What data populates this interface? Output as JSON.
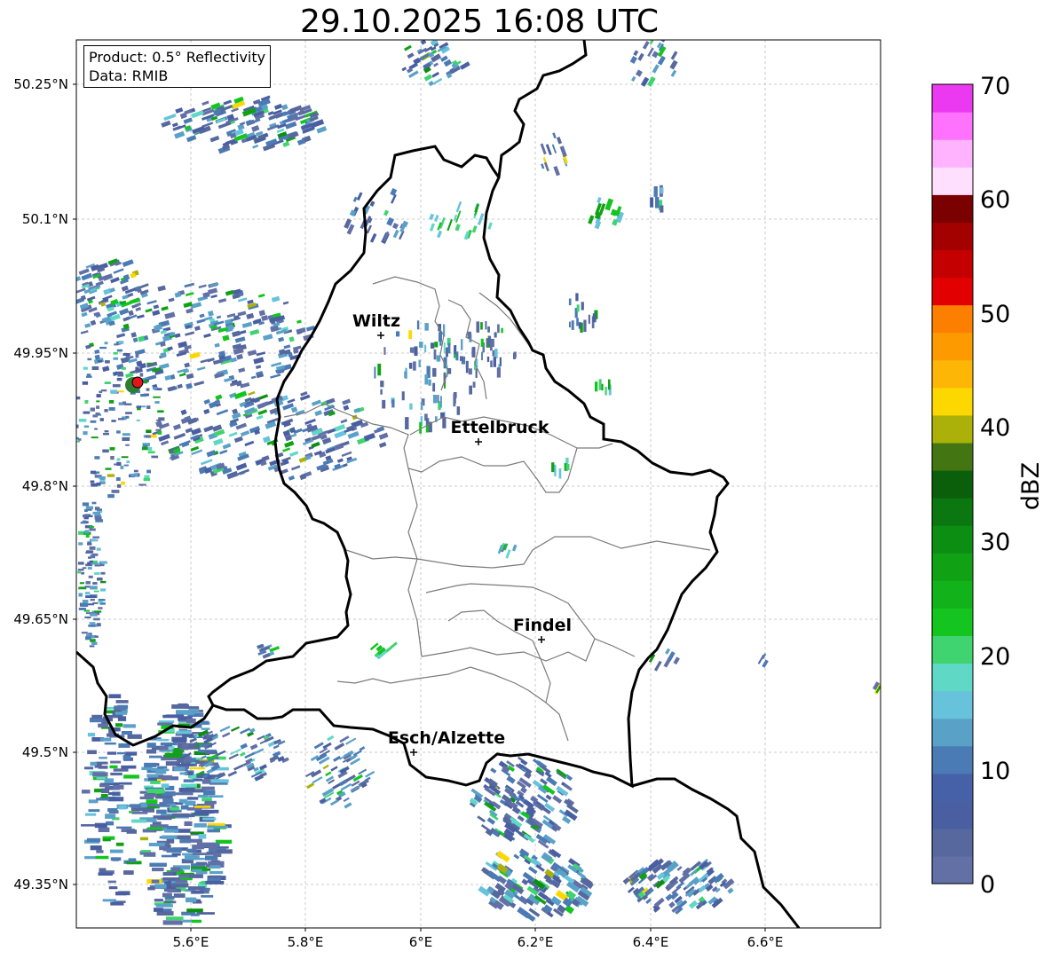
{
  "title": "29.10.2025 16:08 UTC",
  "info": {
    "product": "Product: 0.5° Reflectivity",
    "data": "Data: RMIB"
  },
  "axes": {
    "lat_ticks": [
      "50.25°N",
      "50.1°N",
      "49.95°N",
      "49.8°N",
      "49.65°N",
      "49.5°N",
      "49.35°N"
    ],
    "lon_ticks": [
      "5.6°E",
      "5.8°E",
      "6°E",
      "6.2°E",
      "6.4°E",
      "6.6°E"
    ]
  },
  "cities": [
    {
      "name": "Wiltz"
    },
    {
      "name": "Ettelbruck"
    },
    {
      "name": "Findel"
    },
    {
      "name": "Esch/Alzette"
    }
  ],
  "colorbar": {
    "label": "dBZ",
    "ticks": [
      "0",
      "10",
      "20",
      "30",
      "40",
      "50",
      "60",
      "70"
    ],
    "colors": [
      "#6270a6",
      "#56689e",
      "#4a5fa1",
      "#4661a8",
      "#4b7bb4",
      "#5aa1c8",
      "#67c3dc",
      "#5fd8c6",
      "#3fd46f",
      "#14c41f",
      "#12b21a",
      "#10a114",
      "#0c8e12",
      "#0a7710",
      "#0b5f0b",
      "#437612",
      "#abb109",
      "#fdd700",
      "#fdb506",
      "#fd9a00",
      "#fd7f00",
      "#e20000",
      "#c50000",
      "#a30000",
      "#7b0000",
      "#ffdefe",
      "#ffb3ff",
      "#ff72fe",
      "#ea39f0"
    ]
  },
  "radar_site_color": "#e2151a"
}
